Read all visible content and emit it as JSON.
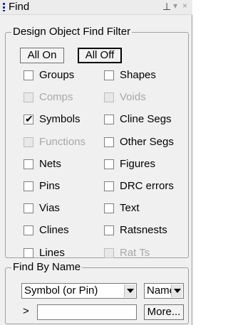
{
  "window": {
    "title": "Find",
    "pin_glyph": "⊥",
    "menu_glyph": "▾",
    "close_glyph": "×"
  },
  "filter": {
    "legend": "Design Object Find Filter",
    "all_on": "All On",
    "all_off": "All Off",
    "items": [
      {
        "label": "Groups",
        "checked": false,
        "enabled": true
      },
      {
        "label": "Shapes",
        "checked": false,
        "enabled": true
      },
      {
        "label": "Comps",
        "checked": false,
        "enabled": false
      },
      {
        "label": "Voids",
        "checked": false,
        "enabled": false
      },
      {
        "label": "Symbols",
        "checked": true,
        "enabled": true
      },
      {
        "label": "Cline Segs",
        "checked": false,
        "enabled": true
      },
      {
        "label": "Functions",
        "checked": false,
        "enabled": false
      },
      {
        "label": "Other Segs",
        "checked": false,
        "enabled": true
      },
      {
        "label": "Nets",
        "checked": false,
        "enabled": true
      },
      {
        "label": "Figures",
        "checked": false,
        "enabled": true
      },
      {
        "label": "Pins",
        "checked": false,
        "enabled": true
      },
      {
        "label": "DRC errors",
        "checked": false,
        "enabled": true
      },
      {
        "label": "Vias",
        "checked": false,
        "enabled": true
      },
      {
        "label": "Text",
        "checked": false,
        "enabled": true
      },
      {
        "label": "Clines",
        "checked": false,
        "enabled": true
      },
      {
        "label": "Ratsnests",
        "checked": false,
        "enabled": true
      },
      {
        "label": "Lines",
        "checked": false,
        "enabled": true
      },
      {
        "label": "Rat Ts",
        "checked": false,
        "enabled": false
      }
    ]
  },
  "find_by_name": {
    "legend": "Find By Name",
    "type_value": "Symbol (or Pin)",
    "mode_value": "Name",
    "prompt": ">",
    "name_value": "",
    "more_button": "More..."
  }
}
